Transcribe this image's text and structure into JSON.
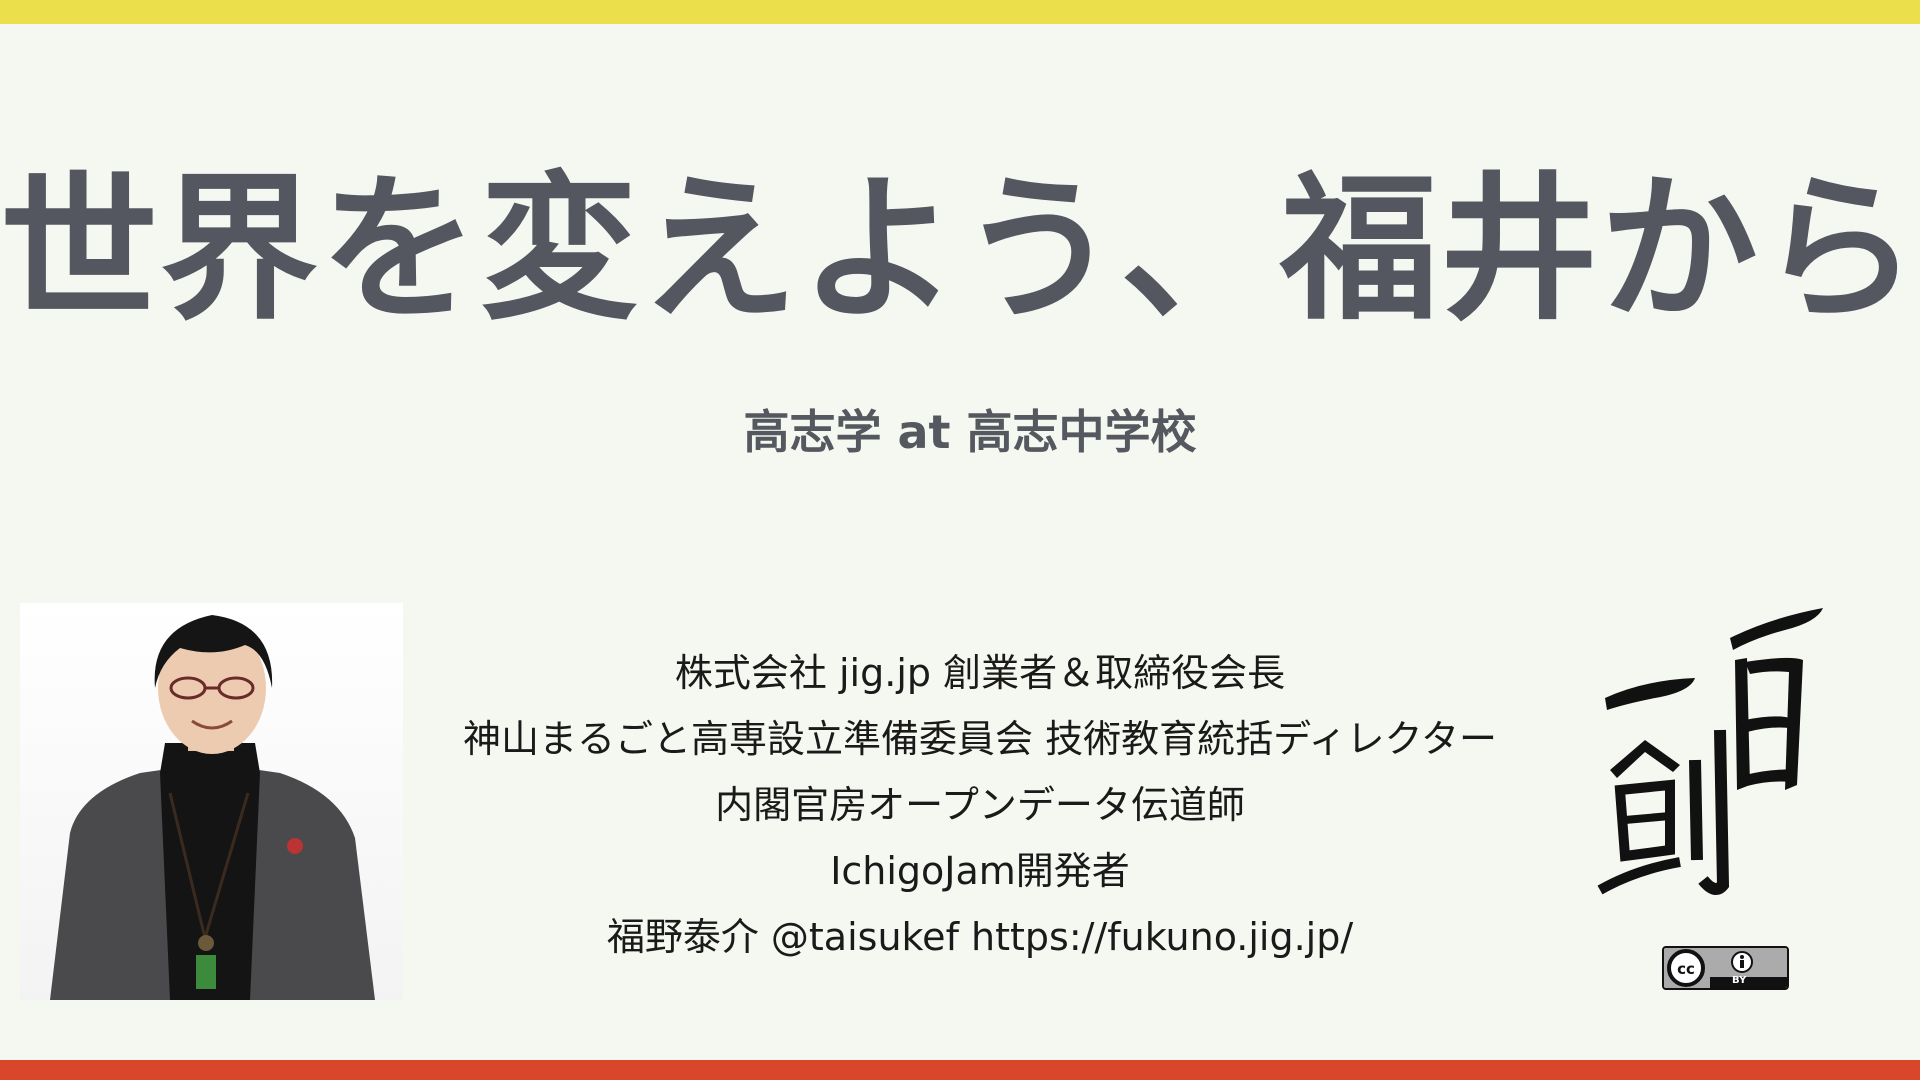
{
  "slide": {
    "title": "世界を変えよう、福井から",
    "subtitle": "高志学 at 高志中学校"
  },
  "profile": {
    "lines": [
      "株式会社 jig.jp 創業者＆取締役会長",
      "神山まるごと高専設立準備委員会 技術教育統括ディレクター",
      "内閣官房オープンデータ伝道師",
      "IchigoJam開発者",
      "福野泰介 @taisukef  https://fukuno.jig.jp/"
    ]
  },
  "license": {
    "badge_text": "BY"
  },
  "colors": {
    "top_bar": "#ebdf4c",
    "bottom_bar": "#d9472a",
    "title": "#545760",
    "background": "#f5f8f1"
  }
}
